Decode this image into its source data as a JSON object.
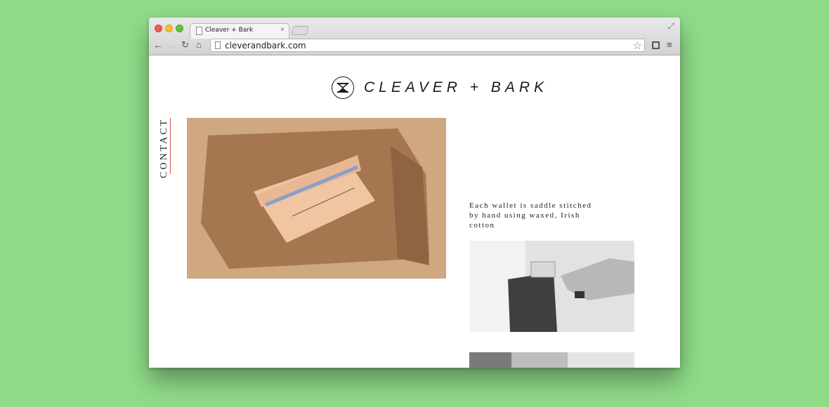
{
  "browser": {
    "tab": {
      "title": "Cleaver + Bark",
      "close_glyph": "×"
    },
    "address_bar": {
      "url": "cleverandbark.com"
    },
    "icons": {
      "back": "arrow-left-icon",
      "forward": "arrow-right-icon",
      "reload": "reload-icon",
      "home": "home-icon",
      "bookmark": "star-icon",
      "menu": "hamburger-menu-icon"
    }
  },
  "site": {
    "logo_text": "CLEAVER + BARK",
    "nav": {
      "contact_label": "CONTACT"
    },
    "caption": "Each wallet is saddle stitched by hand using waxed, Irish cotton"
  },
  "colors": {
    "background": "#8fdb88",
    "accent_line": "#d9534f",
    "text": "#1b1b1b"
  }
}
